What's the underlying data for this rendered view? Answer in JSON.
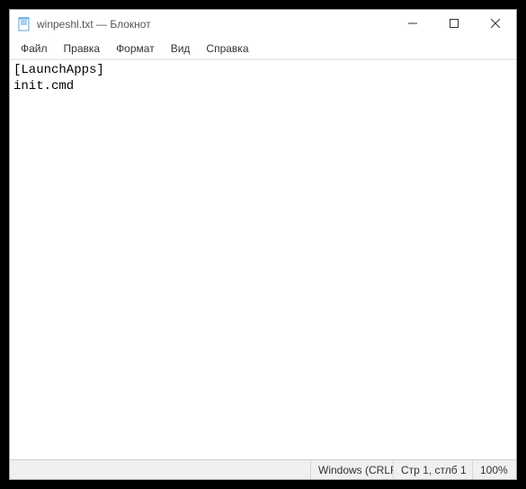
{
  "window": {
    "title": "winpeshl.txt — Блокнот"
  },
  "menu": {
    "file": "Файл",
    "edit": "Правка",
    "format": "Формат",
    "view": "Вид",
    "help": "Справка"
  },
  "editor": {
    "content": "[LaunchApps]\ninit.cmd"
  },
  "status": {
    "encoding": "Windows (CRLF)",
    "caret": "Стр 1, стлб 1",
    "zoom": "100%"
  }
}
